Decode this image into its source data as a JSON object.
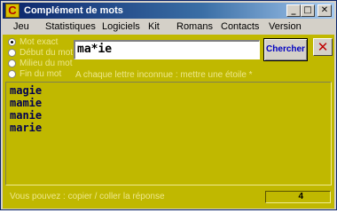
{
  "window": {
    "title": "Complément de mots",
    "app_icon_glyph": "C",
    "minimize_glyph": "_",
    "maximize_glyph": "□",
    "close_glyph": "✕"
  },
  "menu": {
    "items": [
      "Jeu",
      "Statistiques",
      "Logiciels",
      "Kit",
      "Romans",
      "Contacts",
      "Version"
    ]
  },
  "options": {
    "selected": "Mot exact",
    "items": [
      "Mot exact",
      "Début du mot",
      "Milieu du mot",
      "Fin du mot"
    ]
  },
  "search": {
    "value": "ma*ie",
    "button_label": "Chercher",
    "clear_glyph": "✕"
  },
  "hint": "A chaque lettre inconnue : mettre une étoile *",
  "results": [
    "magie",
    "mamie",
    "manie",
    "marie"
  ],
  "status": {
    "text": "Vous pouvez : copier / coller la réponse",
    "count": "4"
  },
  "colors": {
    "client_bg": "#c0b800",
    "label_text": "#eee88a",
    "title_bar": "#0a246a"
  }
}
